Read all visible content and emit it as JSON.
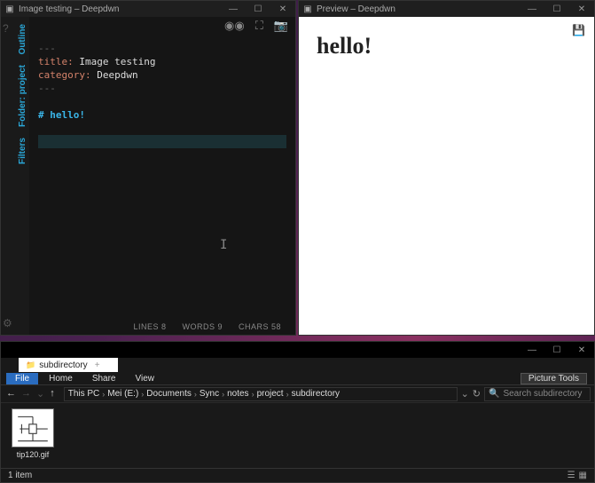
{
  "editor": {
    "title": "Image testing – Deepdwn",
    "sideTabs": [
      "Outline",
      "Folder: project",
      "Filters"
    ],
    "frontmatter": {
      "hr": "---",
      "titleKey": "title:",
      "titleVal": "Image testing",
      "catKey": "category:",
      "catVal": "Deepdwn"
    },
    "headingLine": "# hello!",
    "status": {
      "lines": "LINES  8",
      "words": "WORDS  9",
      "chars": "CHARS  58"
    },
    "icons": {
      "help": "?",
      "gear": "⚙"
    },
    "winControls": {
      "min": "—",
      "max": "☐",
      "close": "✕"
    }
  },
  "preview": {
    "title": "Preview – Deepdwn",
    "heading": "hello!",
    "winControls": {
      "min": "—",
      "max": "☐",
      "close": "✕"
    }
  },
  "explorer": {
    "tab": "subdirectory",
    "ribbon": {
      "file": "File",
      "home": "Home",
      "share": "Share",
      "view": "View",
      "picture": "Picture Tools"
    },
    "nav": {
      "back": "←",
      "fwd": "→",
      "up": "↑"
    },
    "breadcrumb": [
      "This PC",
      "Mei (E:)",
      "Documents",
      "Sync",
      "notes",
      "project",
      "subdirectory"
    ],
    "search": {
      "placeholder": "Search subdirectory",
      "icon": "🔍"
    },
    "addrControls": {
      "dropdown": "⌄",
      "refresh": "↻"
    },
    "file": {
      "name": "tip120.gif"
    },
    "status": {
      "count": "1 item"
    },
    "winControls": {
      "min": "—",
      "max": "☐",
      "close": "✕"
    }
  }
}
